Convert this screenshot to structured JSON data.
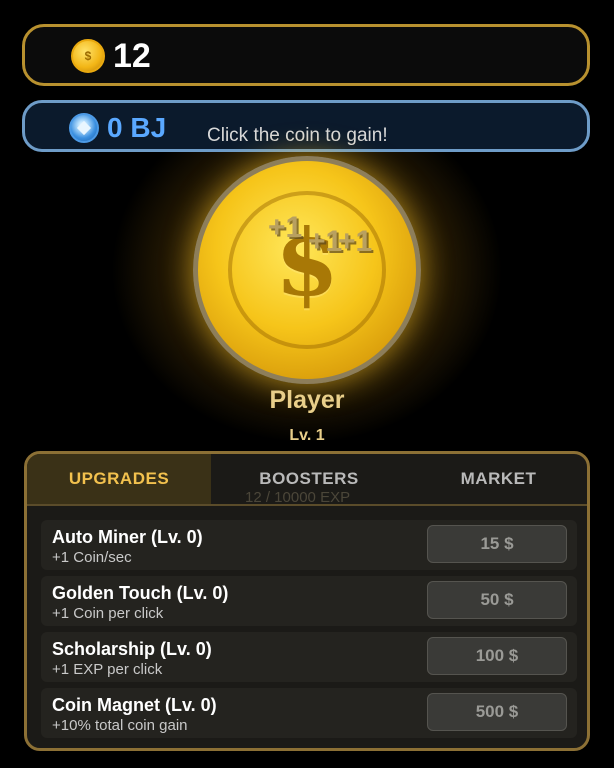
{
  "coins": {
    "amount": "12",
    "icon_glyph": "$"
  },
  "bj": {
    "amount": "0 BJ",
    "hint": "Click the coin to gain!"
  },
  "clicker": {
    "symbol": "$",
    "floating": [
      "+1",
      "+1",
      "+1"
    ]
  },
  "player": {
    "name": "Player",
    "level": "Lv. 1",
    "exp": "12 / 10000 EXP"
  },
  "tabs": [
    {
      "label": "UPGRADES",
      "active": true
    },
    {
      "label": "BOOSTERS",
      "active": false
    },
    {
      "label": "MARKET",
      "active": false
    }
  ],
  "upgrades": [
    {
      "title": "Auto Miner (Lv. 0)",
      "desc": "+1 Coin/sec",
      "price": "15 $"
    },
    {
      "title": "Golden Touch (Lv. 0)",
      "desc": "+1 Coin per click",
      "price": "50 $"
    },
    {
      "title": "Scholarship (Lv. 0)",
      "desc": "+1 EXP per click",
      "price": "100 $"
    },
    {
      "title": "Coin Magnet (Lv. 0)",
      "desc": "+10% total coin gain",
      "price": "500 $"
    }
  ],
  "colors": {
    "gold_accent": "#f2c14e",
    "bj_blue": "#5aa8ff",
    "panel_border": "#8c7035"
  }
}
